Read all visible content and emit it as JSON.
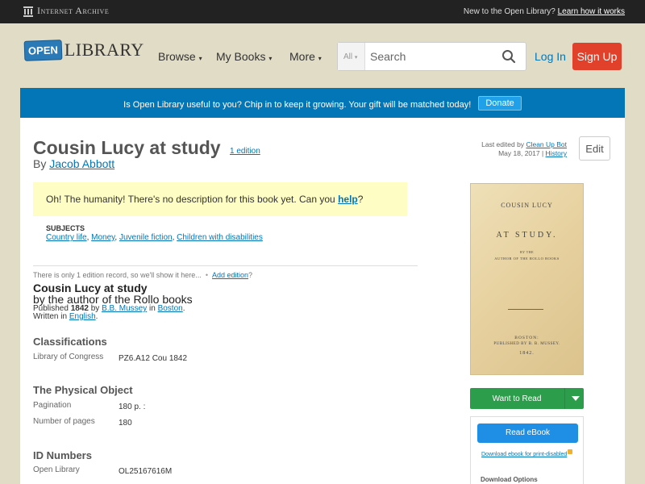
{
  "ia_bar": {
    "logo_text": "Internet Archive",
    "prompt": "New to the Open Library?",
    "link": "Learn how it works"
  },
  "header": {
    "logo_open": "OPEN",
    "logo_library": "LIBRARY",
    "nav": [
      "Browse",
      "My Books",
      "More"
    ],
    "search_scope": "All",
    "search_placeholder": "Search",
    "login": "Log In",
    "signup": "Sign Up"
  },
  "banner": {
    "text": "Is Open Library useful to you? Chip in to keep it growing. Your gift will be matched today!",
    "button": "Donate"
  },
  "work": {
    "title": "Cousin Lucy at study",
    "edition_count": "1 edition",
    "by_prefix": "By",
    "author": "Jacob Abbott",
    "last_edited_prefix": "Last edited by",
    "last_edited_by": "Clean Up Bot",
    "last_edited_date": "May 18, 2017",
    "history": "History",
    "edit": "Edit",
    "description_text": "Oh! The humanity! There's no description for this book yet. Can you",
    "description_link": "help",
    "description_end": "?",
    "subjects_title": "SUBJECTS",
    "subjects": [
      "Country life",
      "Money",
      "Juvenile fiction",
      "Children with disabilities"
    ]
  },
  "edition": {
    "note": "There is only 1 edition record, so we'll show it here...",
    "add_edition": "Add edition",
    "add_edition_suffix": "?",
    "title": "Cousin Lucy at study",
    "byline": "by the author of the Rollo books",
    "published_prefix": "Published",
    "year": "1842",
    "by_word": "by",
    "publisher": "B.B. Mussey",
    "in_word": "in",
    "place": "Boston",
    "written_prefix": "Written in",
    "language": "English"
  },
  "classifications": {
    "title": "Classifications",
    "rows": [
      {
        "label": "Library of Congress",
        "value": "PZ6.A12 Cou 1842"
      }
    ]
  },
  "physical": {
    "title": "The Physical Object",
    "rows": [
      {
        "label": "Pagination",
        "value": "180 p. :"
      },
      {
        "label": "Number of pages",
        "value": "180"
      }
    ]
  },
  "ids": {
    "title": "ID Numbers",
    "rows": [
      {
        "label": "Open Library",
        "value": "OL25167616M"
      }
    ]
  },
  "cover": {
    "line1": "COUSIN LUCY",
    "line2": "AT STUDY.",
    "line3": "BY THE",
    "line4": "AUTHOR OF THE ROLLO BOOKS",
    "line5": "BOSTON:",
    "line6": "PUBLISHED BY B. B. MUSSEY.",
    "line7": "1842."
  },
  "sidebar": {
    "want_to_read": "Want to Read",
    "read_ebook": "Read eBook",
    "print_disabled": "Download ebook for print-disabled",
    "download_options": "Download Options"
  }
}
